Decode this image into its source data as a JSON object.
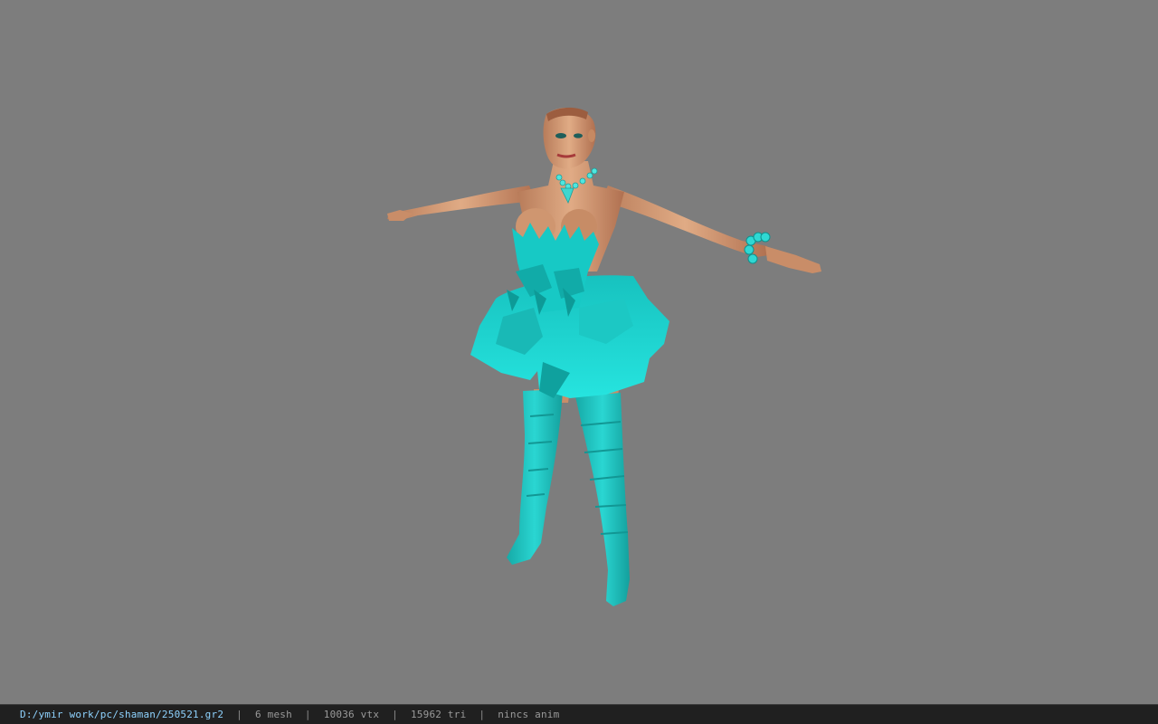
{
  "viewport": {
    "background": "#7d7d7d",
    "model": {
      "name": "character-model",
      "dress_color": "#1fd6d2",
      "skin_color": "#d49a72"
    }
  },
  "statusbar": {
    "file_path": "D:/ymir work/pc/shaman/250521.gr2",
    "separator": "|",
    "mesh_count": "6 mesh",
    "vertex_count": "10036 vtx",
    "triangle_count": "15962 tri",
    "anim_status": "nincs anim"
  }
}
